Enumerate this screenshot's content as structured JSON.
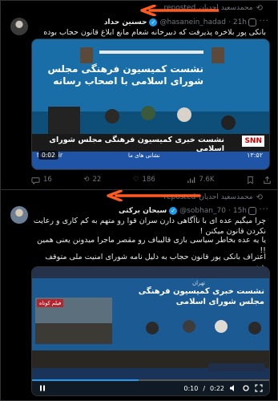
{
  "tweet1": {
    "repost_label": "reposted",
    "reposter": "محمدسعید احدیان",
    "name": "حسنین حداد",
    "handle": "@hasanein_hadad",
    "time": "21h",
    "text": "بانکی پور بلاخره پذیرفت که دبیرخانه شعام مانع ابلاغ قانون حجاب بوده است...!",
    "video": {
      "time": "0:02",
      "banner": "نشست خبری کمیسیون فرهنگی مجلس شورای اسلامی",
      "wall": "نشست کمیسیون فرهنگی مجلس شورای اسلامی با اصحاب رسانه",
      "channel": "SNN",
      "site": "tv.snn.ir",
      "clock": "۱۳:۵۲",
      "small_label": "نشانی های ما"
    },
    "actions": {
      "replies": "16",
      "reposts": "22",
      "likes": "186",
      "views": "7.6K"
    }
  },
  "tweet2": {
    "repost_label": "reposted",
    "reposter": "محمدسعید احدیان",
    "name": "سبحان برکتی",
    "handle": "@sobhan_70",
    "time": "15h",
    "text1": "چرا میگیم عده ای با ناآگاهی دارن سران قوا رو متهم به کم کاری و رعایت نکردن قانون میکنن !",
    "text2": "یا یه عده بخاطر سیاسی بازی قالیباف رو مقصر ماجرا میدونن یعنی همین !!",
    "text3": "اعتراف بانکی پور قانون حجاب به دلیل نامه شورای امنیت ملی متوقف شد .",
    "video": {
      "elapsed": "0:10",
      "total": "0:22",
      "location": "تهران",
      "wall": "نشست خبری کمیسیون فرهنگی مجلس شورای اسلامی",
      "inset": "فیلم کوتاه"
    }
  },
  "colors": {
    "accent": "#1d9bf0",
    "annotation": "#ff5a1f",
    "background": "#000000"
  },
  "icons": [
    "repost-icon",
    "verified-icon",
    "grok-icon",
    "more-icon",
    "reply-icon",
    "like-icon",
    "views-icon",
    "bookmark-icon",
    "share-icon",
    "play-icon",
    "pause-icon",
    "volume-icon",
    "settings-icon",
    "fullscreen-icon"
  ]
}
